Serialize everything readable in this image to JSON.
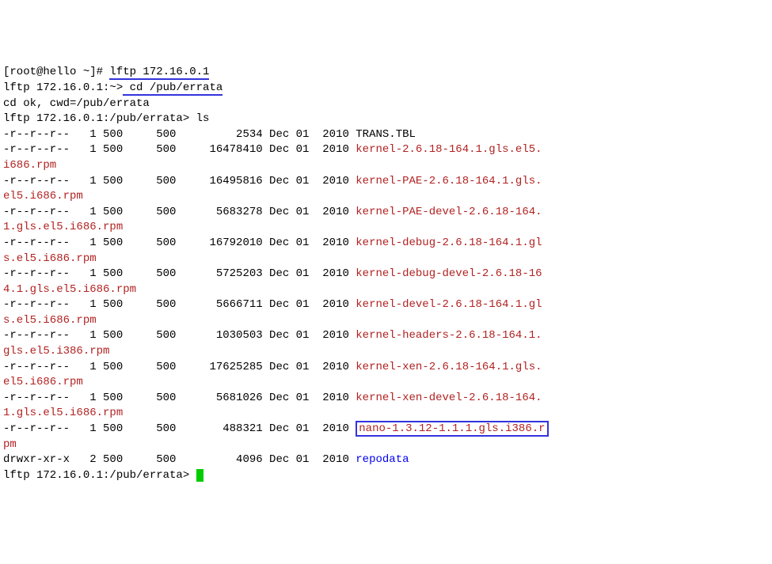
{
  "prompt1_prefix": "[root@hello ~]# ",
  "prompt1_cmd": "lftp 172.16.0.1",
  "prompt2_prefix": "lftp 172.16.0.1:~>",
  "prompt2_cmd": " cd /pub/errata",
  "cdok": "cd ok, cwd=/pub/errata",
  "prompt3": "lftp 172.16.0.1:/pub/errata> ls",
  "files": [
    {
      "perm": "-r--r--r--",
      "links": "1",
      "owner": "500",
      "group": "500",
      "size": "2534",
      "month": "Dec",
      "day": "01",
      "year": "2010",
      "name": "TRANS.TBL",
      "cls": ""
    },
    {
      "perm": "-r--r--r--",
      "links": "1",
      "owner": "500",
      "group": "500",
      "size": "16478410",
      "month": "Dec",
      "day": "01",
      "year": "2010",
      "name": "kernel-2.6.18-164.1.gls.el5.",
      "cls": "red",
      "wrap": "i686.rpm"
    },
    {
      "perm": "-r--r--r--",
      "links": "1",
      "owner": "500",
      "group": "500",
      "size": "16495816",
      "month": "Dec",
      "day": "01",
      "year": "2010",
      "name": "kernel-PAE-2.6.18-164.1.gls.",
      "cls": "red",
      "wrap": "el5.i686.rpm"
    },
    {
      "perm": "-r--r--r--",
      "links": "1",
      "owner": "500",
      "group": "500",
      "size": "5683278",
      "month": "Dec",
      "day": "01",
      "year": "2010",
      "name": "kernel-PAE-devel-2.6.18-164.",
      "cls": "red",
      "wrap": "1.gls.el5.i686.rpm"
    },
    {
      "perm": "-r--r--r--",
      "links": "1",
      "owner": "500",
      "group": "500",
      "size": "16792010",
      "month": "Dec",
      "day": "01",
      "year": "2010",
      "name": "kernel-debug-2.6.18-164.1.gl",
      "cls": "red",
      "wrap": "s.el5.i686.rpm"
    },
    {
      "perm": "-r--r--r--",
      "links": "1",
      "owner": "500",
      "group": "500",
      "size": "5725203",
      "month": "Dec",
      "day": "01",
      "year": "2010",
      "name": "kernel-debug-devel-2.6.18-16",
      "cls": "red",
      "wrap": "4.1.gls.el5.i686.rpm"
    },
    {
      "perm": "-r--r--r--",
      "links": "1",
      "owner": "500",
      "group": "500",
      "size": "5666711",
      "month": "Dec",
      "day": "01",
      "year": "2010",
      "name": "kernel-devel-2.6.18-164.1.gl",
      "cls": "red",
      "wrap": "s.el5.i686.rpm"
    },
    {
      "perm": "-r--r--r--",
      "links": "1",
      "owner": "500",
      "group": "500",
      "size": "1030503",
      "month": "Dec",
      "day": "01",
      "year": "2010",
      "name": "kernel-headers-2.6.18-164.1.",
      "cls": "red",
      "wrap": "gls.el5.i386.rpm"
    },
    {
      "perm": "-r--r--r--",
      "links": "1",
      "owner": "500",
      "group": "500",
      "size": "17625285",
      "month": "Dec",
      "day": "01",
      "year": "2010",
      "name": "kernel-xen-2.6.18-164.1.gls.",
      "cls": "red",
      "wrap": "el5.i686.rpm"
    },
    {
      "perm": "-r--r--r--",
      "links": "1",
      "owner": "500",
      "group": "500",
      "size": "5681026",
      "month": "Dec",
      "day": "01",
      "year": "2010",
      "name": "kernel-xen-devel-2.6.18-164.",
      "cls": "red",
      "wrap": "1.gls.el5.i686.rpm"
    },
    {
      "perm": "-r--r--r--",
      "links": "1",
      "owner": "500",
      "group": "500",
      "size": "488321",
      "month": "Dec",
      "day": "01",
      "year": "2010",
      "name": "nano-1.3.12-1.1.1.gls.i386.r",
      "cls": "red",
      "wrap": "pm",
      "boxed": true
    },
    {
      "perm": "drwxr-xr-x",
      "links": "2",
      "owner": "500",
      "group": "500",
      "size": "4096",
      "month": "Dec",
      "day": "01",
      "year": "2010",
      "name": "repodata",
      "cls": "blue"
    }
  ],
  "prompt4": "lftp 172.16.0.1:/pub/errata> "
}
